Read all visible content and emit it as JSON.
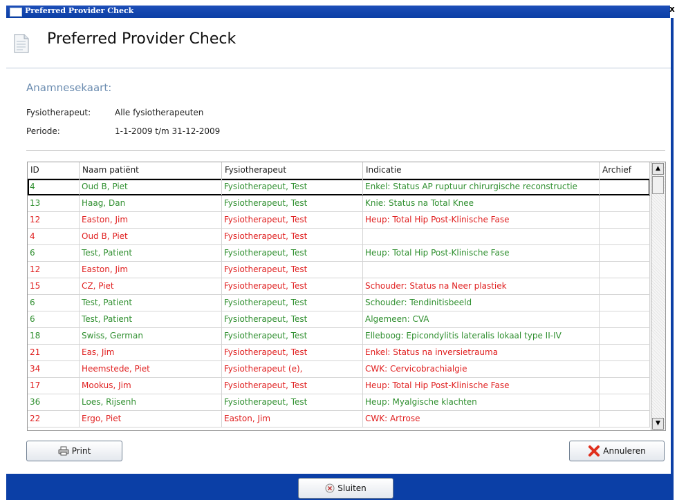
{
  "window": {
    "title": "Preferred Provider Check",
    "close_glyph": "x"
  },
  "header": {
    "title": "Preferred Provider Check",
    "icon": "document-icon"
  },
  "section": {
    "title": "Anamnesekaart:"
  },
  "info": [
    {
      "label": "Fysiotherapeut:",
      "value": "Alle fysiotherapeuten"
    },
    {
      "label": "Periode:",
      "value": "1-1-2009 t/m 31-12-2009"
    }
  ],
  "table": {
    "columns": [
      "ID",
      "Naam patiënt",
      "Fysiotherapeut",
      "Indicatie",
      "Archief"
    ],
    "rows": [
      {
        "id": "4",
        "naam": "Oud B, Piet",
        "fysio": "Fysiotherapeut, Test",
        "indicatie": "Enkel: Status AP ruptuur chirurgische reconstructie",
        "archief": "",
        "color": "#2f8f2f",
        "selected": true
      },
      {
        "id": "13",
        "naam": "Haag, Dan",
        "fysio": "Fysiotherapeut, Test",
        "indicatie": "Knie: Status na Total Knee",
        "archief": "",
        "color": "#2f8f2f",
        "selected": false
      },
      {
        "id": "12",
        "naam": "Easton, Jim",
        "fysio": "Fysiotherapeut, Test",
        "indicatie": "Heup: Total Hip Post-Klinische Fase",
        "archief": "",
        "color": "#e02020",
        "selected": false
      },
      {
        "id": "4",
        "naam": "Oud B, Piet",
        "fysio": "Fysiotherapeut, Test",
        "indicatie": "",
        "archief": "",
        "color": "#e02020",
        "selected": false
      },
      {
        "id": "6",
        "naam": "Test, Patient",
        "fysio": "Fysiotherapeut, Test",
        "indicatie": "Heup: Total Hip Post-Klinische Fase",
        "archief": "",
        "color": "#2f8f2f",
        "selected": false
      },
      {
        "id": "12",
        "naam": "Easton, Jim",
        "fysio": "Fysiotherapeut, Test",
        "indicatie": "",
        "archief": "",
        "color": "#e02020",
        "selected": false
      },
      {
        "id": "15",
        "naam": "CZ, Piet",
        "fysio": "Fysiotherapeut, Test",
        "indicatie": "Schouder: Status na Neer plastiek",
        "archief": "",
        "color": "#e02020",
        "selected": false
      },
      {
        "id": "6",
        "naam": "Test, Patient",
        "fysio": "Fysiotherapeut, Test",
        "indicatie": "Schouder: Tendinitisbeeld",
        "archief": "",
        "color": "#2f8f2f",
        "selected": false
      },
      {
        "id": "6",
        "naam": "Test, Patient",
        "fysio": "Fysiotherapeut, Test",
        "indicatie": "Algemeen: CVA",
        "archief": "",
        "color": "#2f8f2f",
        "selected": false
      },
      {
        "id": "18",
        "naam": "Swiss, German",
        "fysio": "Fysiotherapeut, Test",
        "indicatie": "Elleboog: Epicondylitis lateralis lokaal type II-IV",
        "archief": "",
        "color": "#2f8f2f",
        "selected": false
      },
      {
        "id": "21",
        "naam": "Eas, Jim",
        "fysio": "Fysiotherapeut, Test",
        "indicatie": "Enkel: Status na inversietrauma",
        "archief": "",
        "color": "#e02020",
        "selected": false
      },
      {
        "id": "34",
        "naam": "Heemstede, Piet",
        "fysio": "Fysiotherapeut (e),",
        "indicatie": "CWK: Cervicobrachialgie",
        "archief": "",
        "color": "#e02020",
        "selected": false
      },
      {
        "id": "17",
        "naam": "Mookus, Jim",
        "fysio": "Fysiotherapeut, Test",
        "indicatie": "Heup: Total Hip Post-Klinische Fase",
        "archief": "",
        "color": "#e02020",
        "selected": false
      },
      {
        "id": "36",
        "naam": "Loes, Rijsenh",
        "fysio": "Fysiotherapeut, Test",
        "indicatie": "Heup: Myalgische klachten",
        "archief": "",
        "color": "#2f8f2f",
        "selected": false
      },
      {
        "id": "22",
        "naam": "Ergo, Piet",
        "fysio": "Easton, Jim",
        "indicatie": "CWK: Artrose",
        "archief": "",
        "color": "#e02020",
        "selected": false
      }
    ]
  },
  "buttons": {
    "print": {
      "label": "Print",
      "icon": "printer-icon"
    },
    "cancel": {
      "label": "Annuleren",
      "icon": "red-x-icon"
    },
    "close": {
      "label": "Sluiten",
      "icon": "circle-x-icon"
    }
  },
  "colors": {
    "frame": "#0b3fa6",
    "section_title": "#6b8cb0",
    "ok": "#2f8f2f",
    "warn": "#e02020"
  }
}
